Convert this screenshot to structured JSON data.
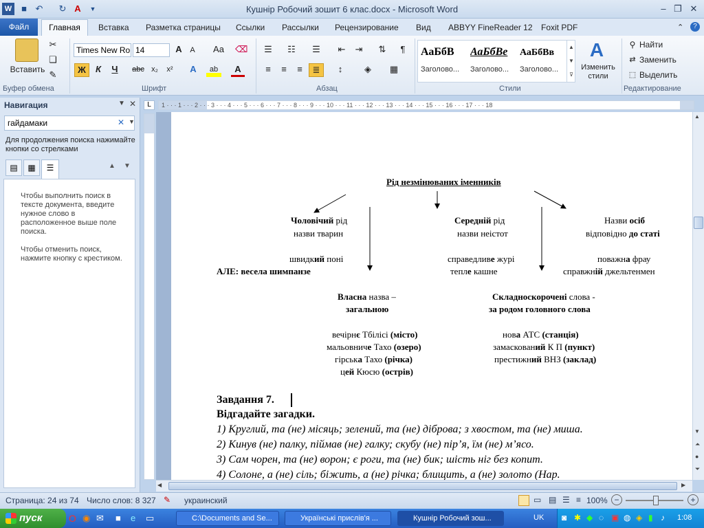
{
  "window": {
    "title": "Кушнір Робочий зошит 6 клас.docx - Microsoft Word"
  },
  "tabs": [
    "Файл",
    "Главная",
    "Вставка",
    "Разметка страницы",
    "Ссылки",
    "Рассылки",
    "Рецензирование",
    "Вид",
    "ABBYY FineReader 12",
    "Foxit PDF"
  ],
  "ribbon": {
    "clipboard": {
      "label": "Буфер обмена",
      "paste": "Вставить"
    },
    "font": {
      "label": "Шрифт",
      "font_name": "Times New Ro",
      "font_size": "14",
      "case": "Аа",
      "bold": "Ж",
      "italic": "К",
      "underline": "Ч",
      "strike": "abc",
      "sub": "x₂",
      "sup": "x²"
    },
    "paragraph": {
      "label": "Абзац"
    },
    "styles": {
      "label": "Стили",
      "items": [
        {
          "preview": "АаБбВ",
          "name": "Заголово..."
        },
        {
          "preview": "АаБбВе",
          "name": "Заголово..."
        },
        {
          "preview": "АаБбВв",
          "name": "Заголово..."
        }
      ],
      "change": "Изменить стили"
    },
    "editing": {
      "label": "Редактирование",
      "find": "Найти",
      "replace": "Заменить",
      "select": "Выделить"
    }
  },
  "nav": {
    "title": "Навигация",
    "search_value": "гайдамаки",
    "hint": "Для продолжения поиска нажимайте кнопки со стрелками",
    "msg1": "Чтобы выполнить поиск в тексте документа, введите нужное слово в расположенное выше поле поиска.",
    "msg2": "Чтобы отменить поиск, нажмите кнопку с крестиком."
  },
  "document": {
    "heading": "Рід незмінюваних іменників",
    "col1_title_b": "Чоловічий",
    "col1_title_r": " рід",
    "col1_sub": "назви тварин",
    "col1_ex1_r": "швидк",
    "col1_ex1_b": "ий",
    "col1_ex1_r2": " поні",
    "col1_ex2": "АЛЕ: весела шимпанзе",
    "col2_title_b": "Середній",
    "col2_title_r": " рід",
    "col2_sub": "назви неістот",
    "col2_ex1_r": "справедлив",
    "col2_ex1_b": "е",
    "col2_ex1_r2": " журі",
    "col2_ex2_r": "тепл",
    "col2_ex2_b": "е",
    "col2_ex2_r2": " кашне",
    "col3_title_r": "Назви ",
    "col3_title_b": "осіб",
    "col3_sub_r": "відповідно ",
    "col3_sub_b": "до статі",
    "col3_ex1_r": "поважн",
    "col3_ex1_b": "а",
    "col3_ex1_r2": " фрау",
    "col3_ex2_r": "справжн",
    "col3_ex2_b": "ій",
    "col3_ex2_r2": " джельтенмен",
    "prop_title_b": "Власна",
    "prop_title_r": " назва –",
    "prop_sub": "загальною",
    "prop_ex": [
      {
        "r": "вечірн",
        "b": "є",
        "r2": " Тбілісі ",
        "b2": "(місто)"
      },
      {
        "r": "мальовнич",
        "b": "е",
        "r2": " Тахо ",
        "b2": "(озеро)"
      },
      {
        "r": "гірськ",
        "b": "а",
        "r2": " Тахо ",
        "b2": "(річка)"
      },
      {
        "r": "ц",
        "b": "ей",
        "r2": " Кюсю ",
        "b2": "(острів)"
      }
    ],
    "abbr_title_b": "Складноскорочені",
    "abbr_title_r": " слова -",
    "abbr_sub": "за родом головного слова",
    "abbr_ex": [
      {
        "r": "нов",
        "b": "а",
        "r2": " АТС ",
        "b2": "(станція)"
      },
      {
        "r": "замаскован",
        "b": "ий",
        "r2": " К П ",
        "b2": "(пункт)"
      },
      {
        "r": "престижн",
        "b": "ий",
        "r2": " ВНЗ ",
        "b2": "(заклад)"
      }
    ],
    "task_title": "Завдання 7.",
    "task_sub": "Відгадайте загадки.",
    "riddles": [
      "1) Круглий, та (не) місяць; зелений, та (не) діброва; з хвостом, та (не) миша.",
      "2) Кинув (не) палку, піймав (не) галку; скубу (не) пір’я, їм (не) м’ясо.",
      "3) Сам чорен, та (не) ворон; є роги, та (не) бик; шість ніг без копит.",
      "4) Солоне, а (не) сіль; біжить, а (не) річка; блищить, а (не) золото (Нар."
    ]
  },
  "status": {
    "page": "Страница: 24 из 74",
    "words": "Число слов: 8 327",
    "lang": "украинский",
    "zoom": "100%"
  },
  "taskbar": {
    "start": "пуск",
    "tasks": [
      "C:\\Documents and Se...",
      "Українські прислів'я ...",
      "Кушнір Робочий зош..."
    ],
    "lang": "UK",
    "time": "1:08"
  }
}
